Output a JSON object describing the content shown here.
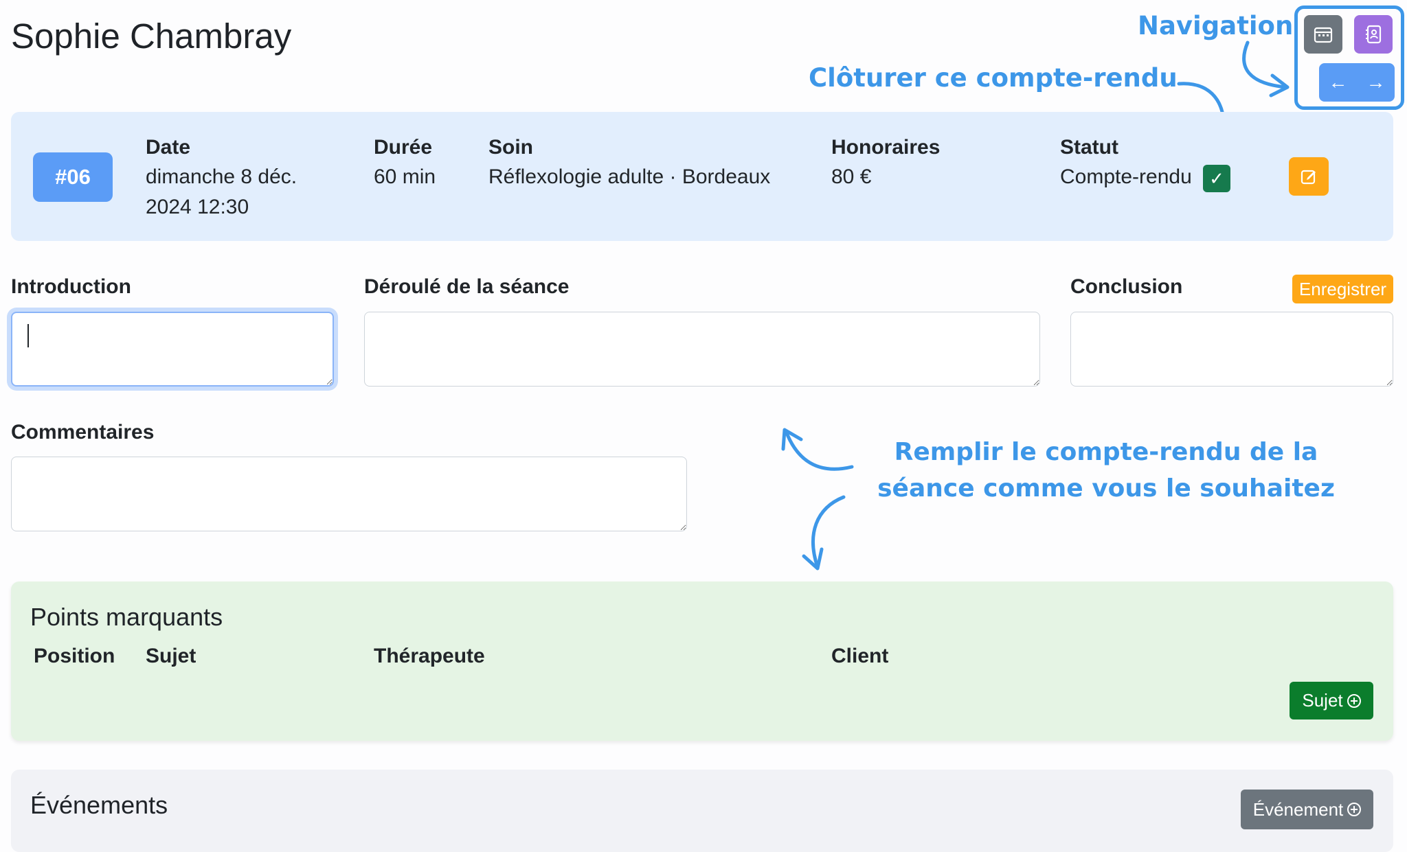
{
  "header": {
    "title": "Sophie Chambray"
  },
  "annotations": {
    "navigation": "Navigation",
    "close_report": "Clôturer ce compte-rendu",
    "fill_line1": "Remplir le compte-rendu de la",
    "fill_line2": "séance comme vous le souhaitez"
  },
  "nav": {
    "calendar_icon": "calendar-icon",
    "contacts_icon": "address-book-icon",
    "prev": "←",
    "next": "→"
  },
  "session": {
    "number": "#06",
    "date_label": "Date",
    "date_line1": "dimanche 8 déc.",
    "date_line2": "2024 12:30",
    "duration_label": "Durée",
    "duration_value": "60 min",
    "care_label": "Soin",
    "care_value": "Réflexologie adulte · Bordeaux",
    "fees_label": "Honoraires",
    "fees_value": "80 €",
    "status_label": "Statut",
    "status_value": "Compte-rendu",
    "status_check": "✓",
    "status_color": "#167a4d",
    "edit_color": "#fea716"
  },
  "form": {
    "introduction_label": "Introduction",
    "introduction_value": "",
    "deroule_label": "Déroulé de la séance",
    "deroule_value": "",
    "conclusion_label": "Conclusion",
    "conclusion_value": "",
    "save_label": "Enregistrer",
    "comments_label": "Commentaires",
    "comments_value": ""
  },
  "points": {
    "title": "Points marquants",
    "columns": [
      "Position",
      "Sujet",
      "Thérapeute",
      "Client"
    ],
    "rows": [],
    "add_button": "Sujet"
  },
  "events": {
    "title": "Événements",
    "add_button": "Événement"
  },
  "colors": {
    "annotation": "#3d97e8",
    "primary": "#5b9cf6",
    "warning": "#fea716",
    "success": "#0b7d2c",
    "secondary": "#6c757d",
    "purple": "#9d6fe0"
  }
}
